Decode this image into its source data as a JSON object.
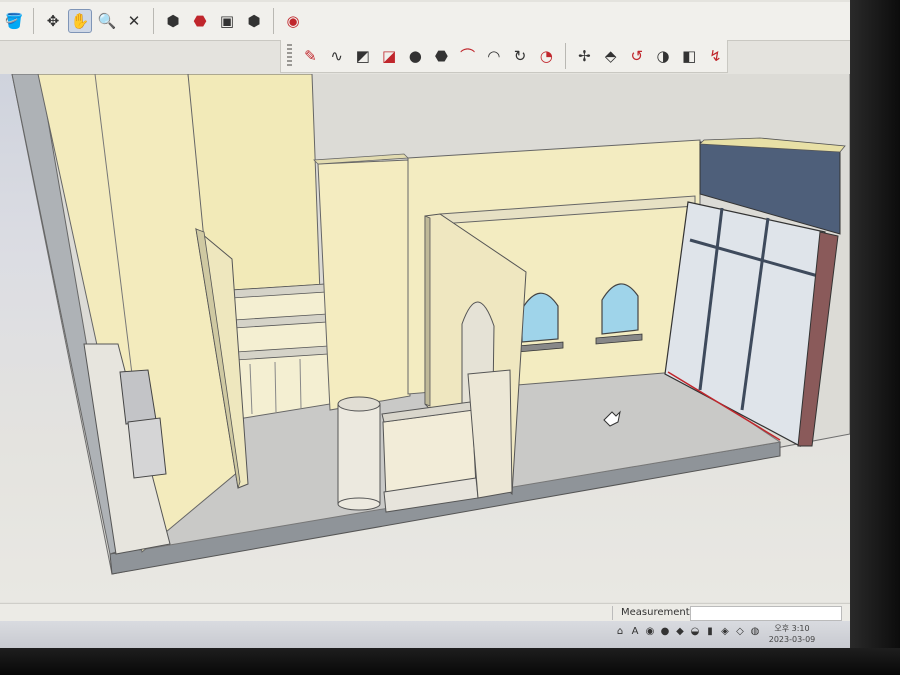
{
  "toolbar_top": {
    "tools": [
      {
        "name": "paint-bucket-icon",
        "glyph": "🪣",
        "active": false
      },
      {
        "name": "orbit-icon",
        "glyph": "✥",
        "active": false
      },
      {
        "name": "pan-hand-icon",
        "glyph": "✋",
        "active": true
      },
      {
        "name": "zoom-icon",
        "glyph": "🔍",
        "active": false
      },
      {
        "name": "zoom-extents-icon",
        "glyph": "✕",
        "active": false
      },
      {
        "name": "warehouse-icon",
        "glyph": "⬢",
        "active": false
      },
      {
        "name": "share-model-icon",
        "glyph": "⬣",
        "active": false
      },
      {
        "name": "layout-icon",
        "glyph": "▣",
        "active": false
      },
      {
        "name": "extension-warehouse-icon",
        "glyph": "⬢",
        "active": false
      },
      {
        "name": "account-icon",
        "glyph": "◉",
        "active": false
      }
    ]
  },
  "toolbar_second": {
    "tools": [
      {
        "name": "pencil-icon",
        "glyph": "✎"
      },
      {
        "name": "freehand-icon",
        "glyph": "∿"
      },
      {
        "name": "rectangle-icon",
        "glyph": "◩"
      },
      {
        "name": "rotated-rectangle-icon",
        "glyph": "◪"
      },
      {
        "name": "circle-icon",
        "glyph": "●"
      },
      {
        "name": "polygon-icon",
        "glyph": "⬣"
      },
      {
        "name": "arc-icon",
        "glyph": "⌒"
      },
      {
        "name": "two-point-arc-icon",
        "glyph": "◠"
      },
      {
        "name": "three-point-arc-icon",
        "glyph": "↻"
      },
      {
        "name": "pie-icon",
        "glyph": "◔"
      },
      {
        "name": "move-icon",
        "glyph": "✢"
      },
      {
        "name": "push-pull-icon",
        "glyph": "⬘"
      },
      {
        "name": "rotate-icon",
        "glyph": "↺"
      },
      {
        "name": "follow-me-icon",
        "glyph": "◑"
      },
      {
        "name": "scale-icon",
        "glyph": "◧"
      },
      {
        "name": "offset-icon",
        "glyph": "↯"
      }
    ]
  },
  "colors": {
    "accent_red": "#c0262c",
    "wall_yellow": "#f3ebbd",
    "window_blue": "#9fd4ea",
    "floor_grey": "#c9c9c7"
  },
  "statusbar": {
    "measurements_label": "Measurements"
  },
  "taskbar": {
    "clock_time": "오후 3:10",
    "clock_date": "2023-03-09"
  }
}
